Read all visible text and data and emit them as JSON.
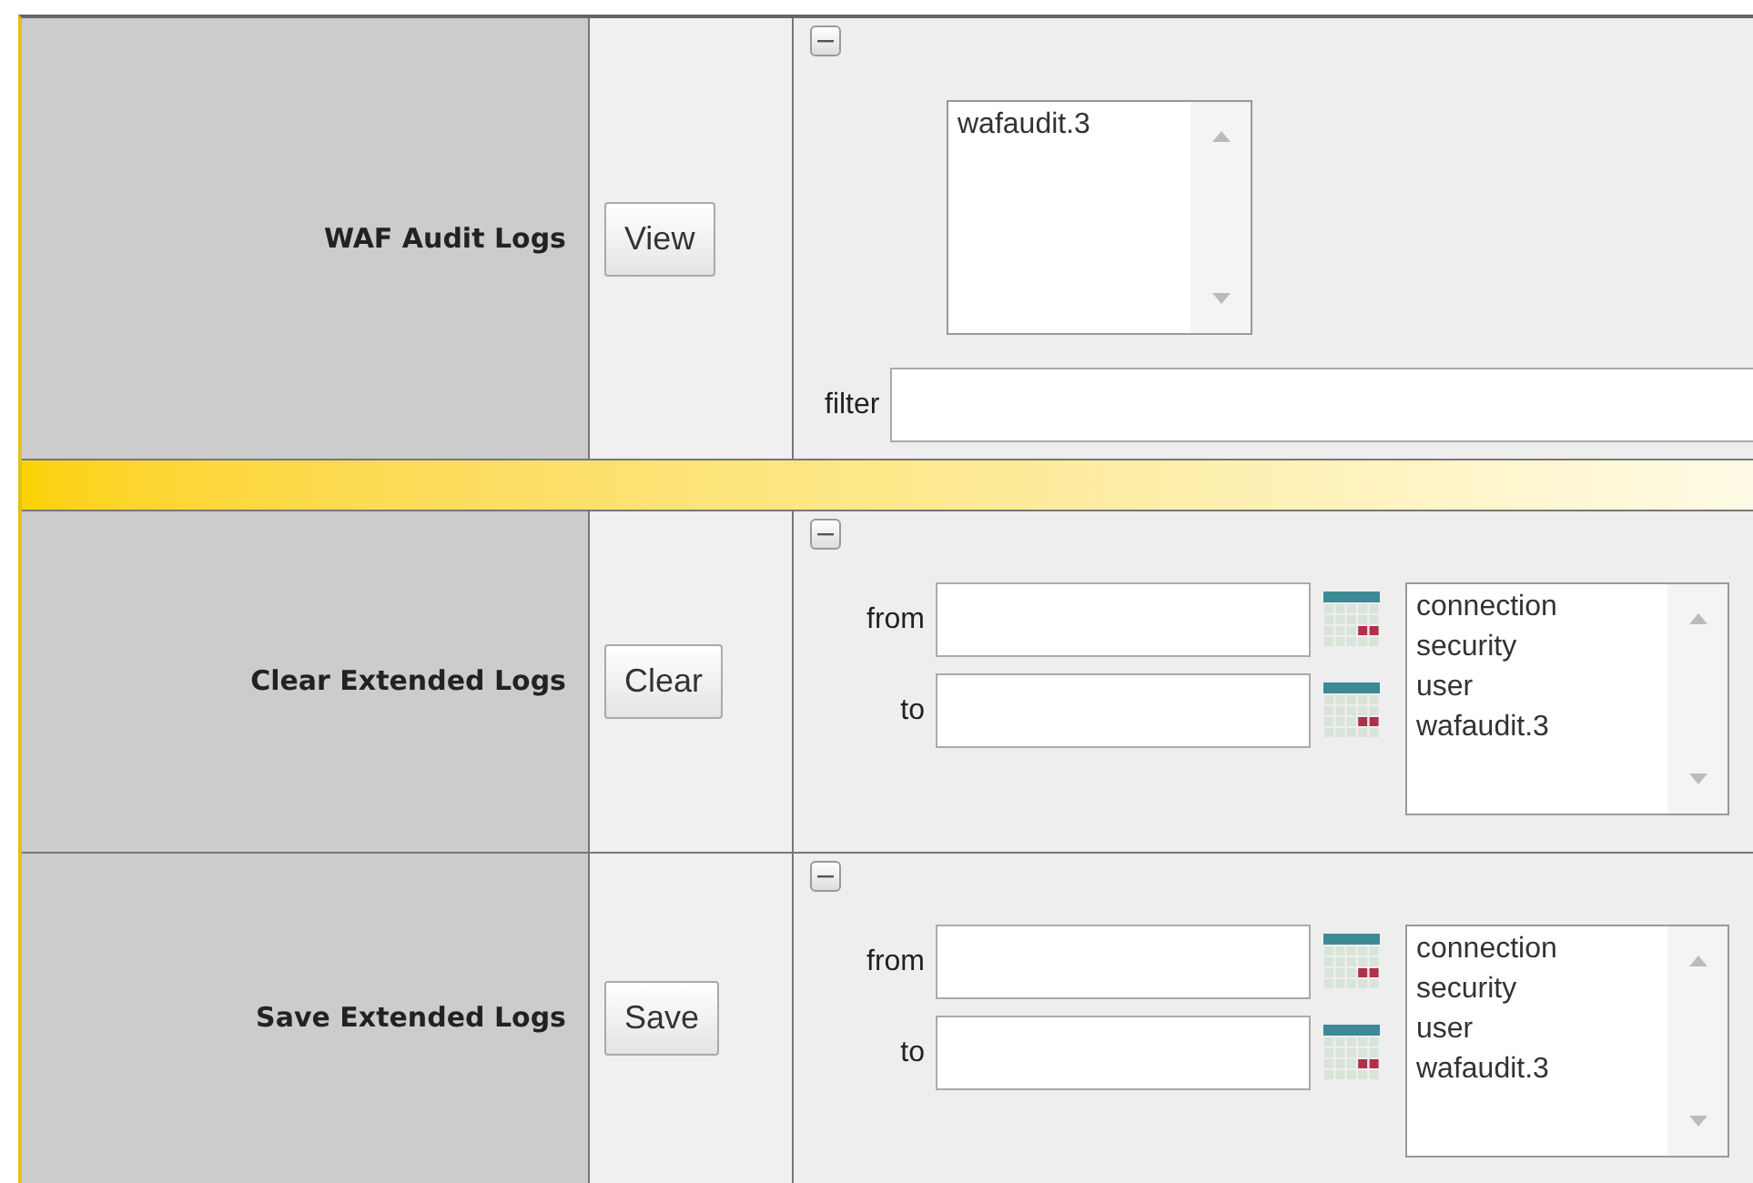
{
  "sections": [
    {
      "kind": "audit",
      "label": "WAF Audit Logs",
      "button": "View",
      "options": [
        "wafaudit.3"
      ],
      "filter_label": "filter"
    },
    {
      "kind": "range",
      "label": "Clear Extended Logs",
      "button": "Clear",
      "from_label": "from",
      "to_label": "to",
      "options": [
        "connection",
        "security",
        "user",
        "wafaudit.3"
      ]
    },
    {
      "kind": "range",
      "label": "Save Extended Logs",
      "button": "Save",
      "from_label": "from",
      "to_label": "to",
      "options": [
        "connection",
        "security",
        "user",
        "wafaudit.3"
      ]
    }
  ]
}
